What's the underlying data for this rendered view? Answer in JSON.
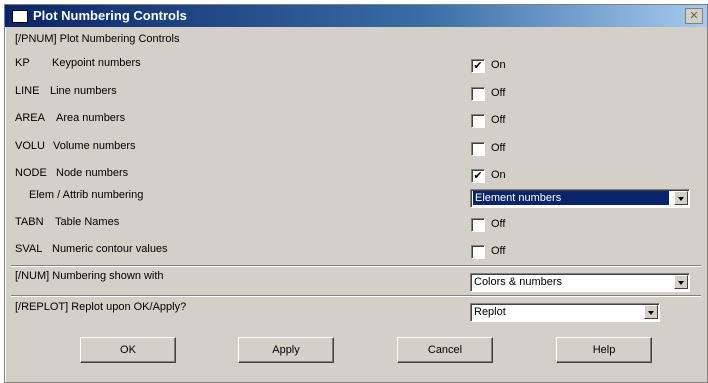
{
  "window": {
    "title": "Plot Numbering Controls",
    "close_glyph": "✕"
  },
  "header": "[/PNUM] Plot Numbering Controls",
  "rows": [
    {
      "code": "KP",
      "label": "Keypoint numbers",
      "checked": true,
      "state": "On"
    },
    {
      "code": "LINE",
      "label": "Line numbers",
      "checked": false,
      "state": "Off"
    },
    {
      "code": "AREA",
      "label": "Area numbers",
      "checked": false,
      "state": "Off"
    },
    {
      "code": "VOLU",
      "label": "Volume numbers",
      "checked": false,
      "state": "Off"
    },
    {
      "code": "NODE",
      "label": "Node numbers",
      "checked": true,
      "state": "On"
    },
    {
      "code": "TABN",
      "label": "Table Names",
      "checked": false,
      "state": "Off"
    },
    {
      "code": "SVAL",
      "label": "Numeric contour values",
      "checked": false,
      "state": "Off"
    }
  ],
  "check_glyph": "✔",
  "elem_attrib": {
    "label": "Elem / Attrib numbering",
    "value": "Element numbers"
  },
  "num": {
    "label": "[/NUM]  Numbering shown with",
    "value": "Colors & numbers"
  },
  "replot": {
    "label": "[/REPLOT] Replot upon OK/Apply?",
    "value": "Replot"
  },
  "buttons": {
    "ok": "OK",
    "apply": "Apply",
    "cancel": "Cancel",
    "help": "Help"
  }
}
